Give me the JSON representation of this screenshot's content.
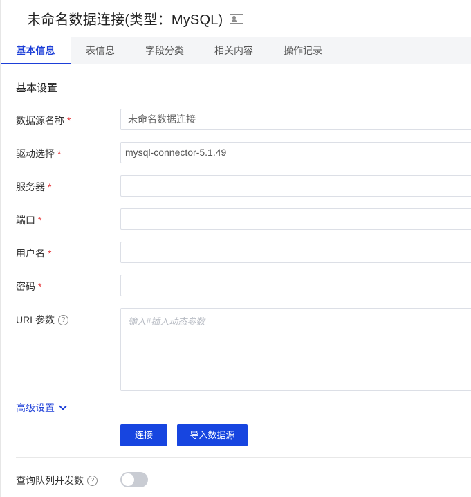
{
  "header": {
    "title": "未命名数据连接(类型：MySQL)",
    "title_icon": "id-card-icon"
  },
  "tabs": [
    {
      "label": "基本信息",
      "active": true
    },
    {
      "label": "表信息",
      "active": false
    },
    {
      "label": "字段分类",
      "active": false
    },
    {
      "label": "相关内容",
      "active": false
    },
    {
      "label": "操作记录",
      "active": false
    }
  ],
  "section": {
    "title": "基本设置"
  },
  "form": {
    "datasource_name": {
      "label": "数据源名称",
      "required": "*",
      "value": "未命名数据连接"
    },
    "driver": {
      "label": "驱动选择",
      "required": "*",
      "value": "mysql-connector-5.1.49"
    },
    "server": {
      "label": "服务器",
      "required": "*",
      "value": ""
    },
    "port": {
      "label": "端口",
      "required": "*",
      "value": ""
    },
    "username": {
      "label": "用户名",
      "required": "*",
      "value": ""
    },
    "password": {
      "label": "密码",
      "required": "*",
      "value": ""
    },
    "url_params": {
      "label": "URL参数",
      "help_icon": "?",
      "placeholder": "输入#插入动态参数"
    }
  },
  "advanced": {
    "label": "高级设置"
  },
  "buttons": {
    "connect": "连接",
    "import": "导入数据源"
  },
  "concurrency": {
    "label": "查询队列并发数",
    "help_icon": "?",
    "enabled": false
  },
  "colors": {
    "accent": "#1d3fd8",
    "button": "#1745e0",
    "required": "#e5383b",
    "tab_bar": "#f4f5f7"
  }
}
